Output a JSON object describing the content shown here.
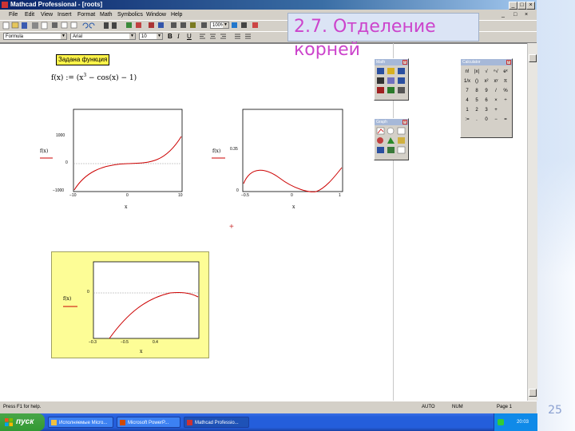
{
  "window": {
    "title": "Mathcad Professional - [roots]",
    "buttons": [
      "_",
      "□",
      "×"
    ]
  },
  "menu": {
    "items": [
      "File",
      "Edit",
      "View",
      "Insert",
      "Format",
      "Math",
      "Symbolics",
      "Window",
      "Help"
    ],
    "right": [
      "_",
      "□",
      "×"
    ]
  },
  "toolbar": {
    "style_value": "Formula",
    "font_value": "Arial",
    "size_value": "10",
    "zoom_value": "100%",
    "bold": "B",
    "italic": "I",
    "underline": "U"
  },
  "slide": {
    "title_line1": "2.7.  Отделение",
    "title_line2": "корней",
    "page_number": "25"
  },
  "worksheet": {
    "given_label": "Задана функция",
    "formula_name": "f(x)",
    "formula_assign": ":=",
    "formula_body": "(x",
    "formula_exp": "3",
    "formula_rest": " − cos(x) − 1)",
    "cursor": "+"
  },
  "plots": [
    {
      "ylabel": "f(x)",
      "xlabel": "x",
      "yticks": [
        "1000",
        "0",
        "−1000"
      ],
      "xticks": [
        "−10",
        "0",
        "10"
      ]
    },
    {
      "ylabel": "f(x)",
      "xlabel": "x",
      "yticks": [
        "0.35",
        "0"
      ],
      "xticks": [
        "−0.5",
        "0",
        "1"
      ]
    },
    {
      "ylabel": "f(x)",
      "xlabel": "x",
      "yticks": [
        "0"
      ],
      "xticks": [
        "−0.3",
        "−0.5",
        "0.4"
      ]
    }
  ],
  "palettes": {
    "math": {
      "title": "Math",
      "close": "×"
    },
    "graph": {
      "title": "Graph",
      "close": "×"
    },
    "calculator": {
      "title": "Calculator",
      "close": "×",
      "keys": [
        "n!",
        "|x|",
        "√",
        "ⁿ√",
        "eˣ",
        "1/x",
        "()",
        "x²",
        "xʸ",
        "π",
        "7",
        "8",
        "9",
        "/",
        "%",
        "4",
        "5",
        "6",
        "×",
        "÷",
        "1",
        "2",
        "3",
        "+",
        ":=",
        ".",
        "0",
        "−",
        "="
      ]
    }
  },
  "status": {
    "help": "Press F1 for help.",
    "mode": "AUTO",
    "num": "NUM",
    "page": "Page 1"
  },
  "taskbar": {
    "start_label": "пуск",
    "items": [
      "Исполняемые Micro...",
      "Microsoft PowerP...",
      "Mathcad Professio..."
    ],
    "clock": "20:03"
  },
  "colors": {
    "title_pink": "#cc44cc",
    "curve_red": "#cc0000",
    "yellow_label": "#fff44a",
    "yellow_box": "#fdfd96"
  }
}
